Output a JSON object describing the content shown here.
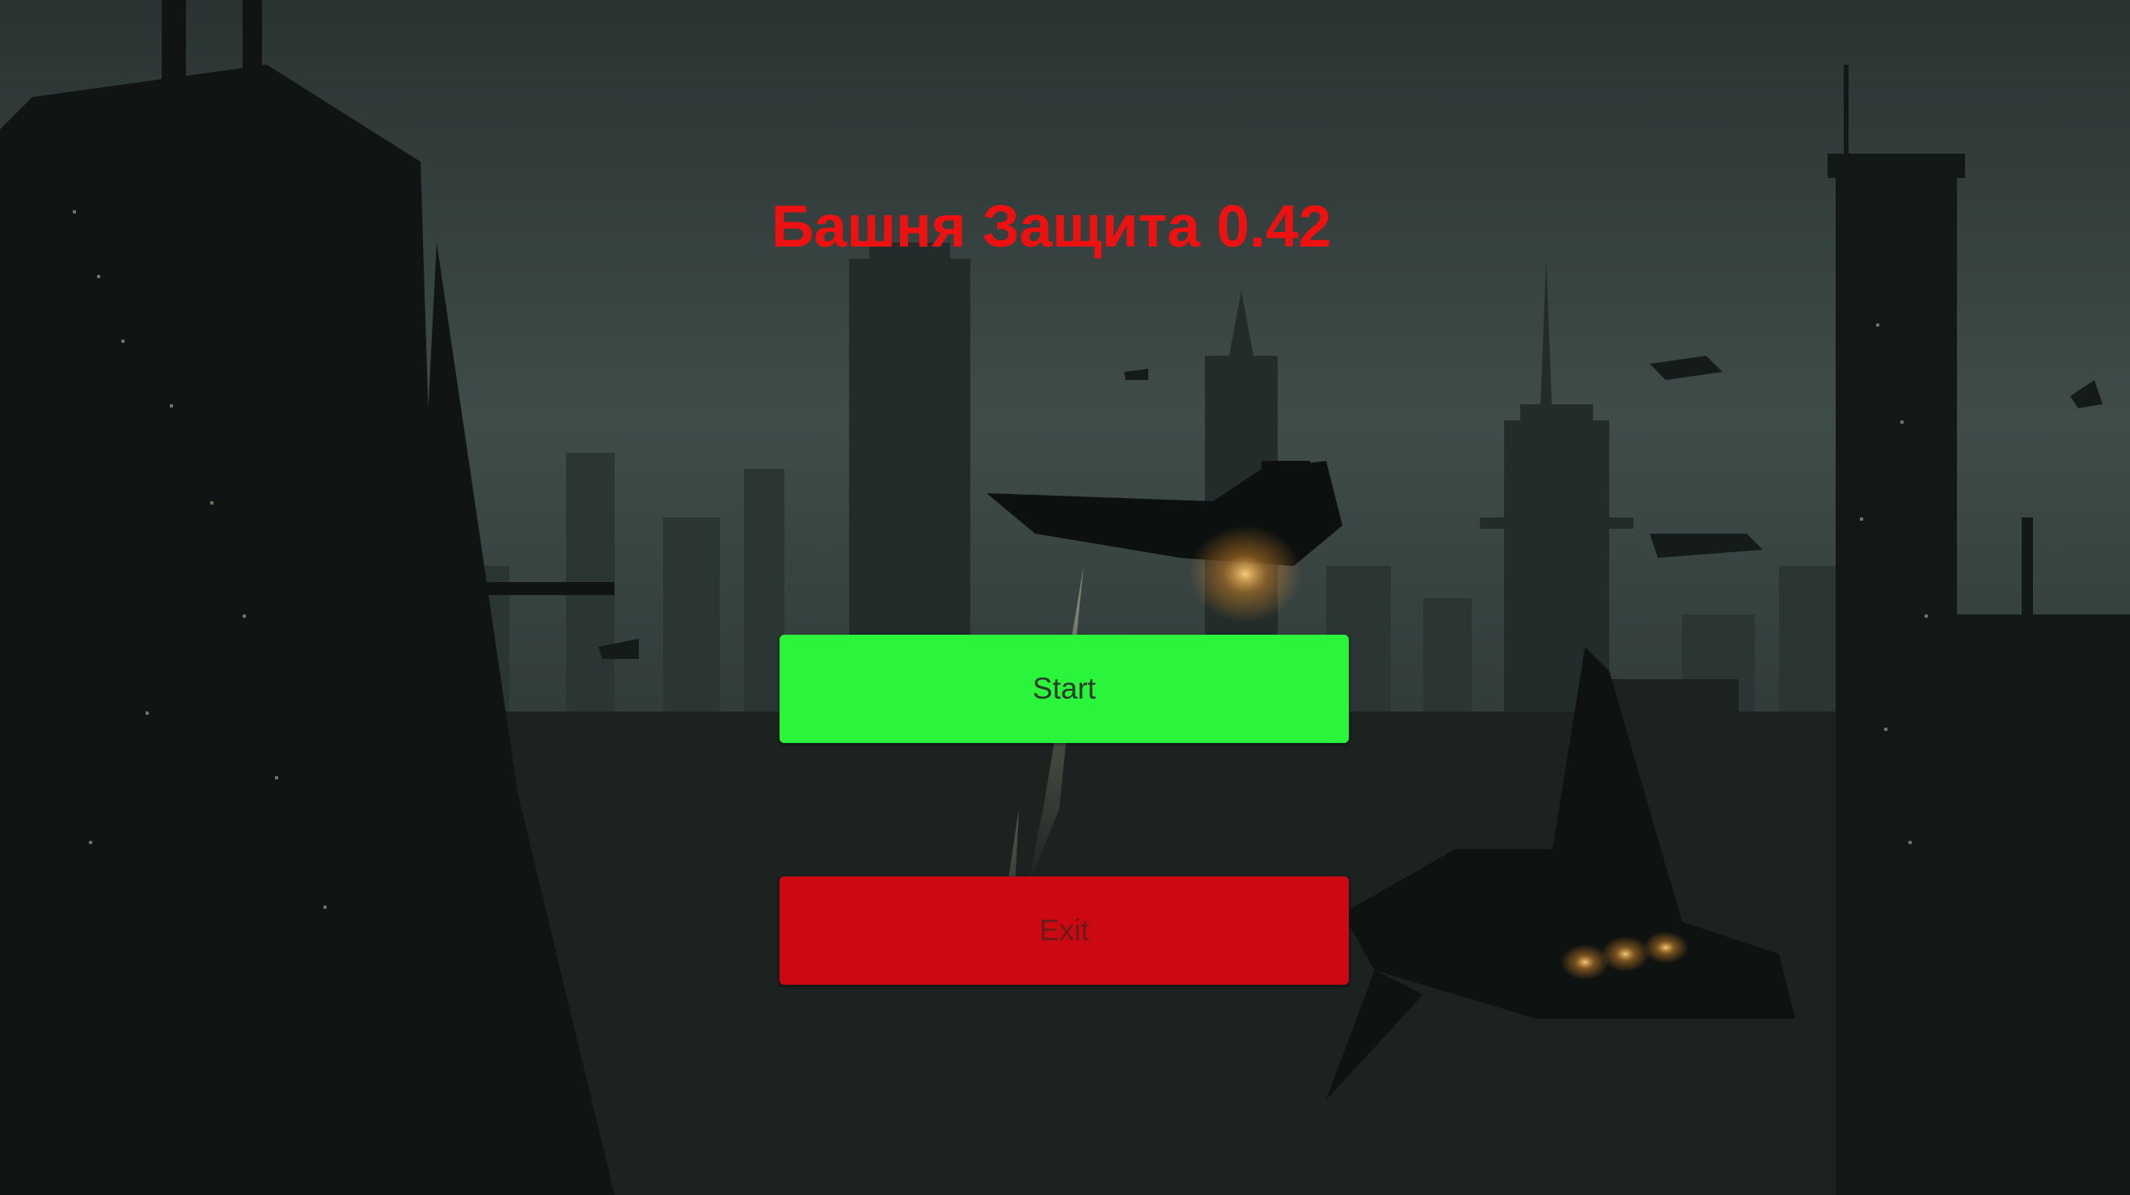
{
  "game": {
    "title": "Башня Защита 0.42"
  },
  "menu": {
    "start_label": "Start",
    "exit_label": "Exit"
  },
  "colors": {
    "title": "#ee1111",
    "start_button": "#2af53a",
    "exit_button": "#cc0813",
    "sky": "#3d4a47",
    "city": "#111614"
  },
  "background": {
    "icon": "futuristic-city-background-icon"
  }
}
